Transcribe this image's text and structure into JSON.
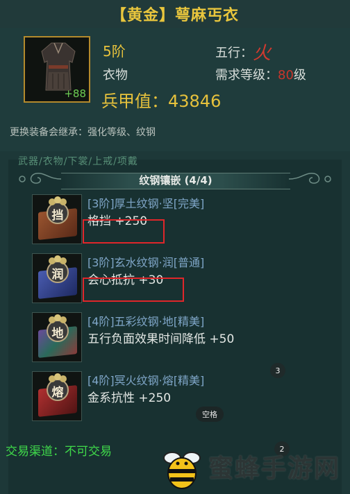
{
  "header": {
    "title": "【黄金】萼麻丐衣"
  },
  "item": {
    "enhance_level": "+88",
    "tier": "5阶",
    "type": "衣物",
    "element_label": "五行：",
    "element_glyph": "火",
    "req_label": "需求等级：",
    "req_level": "80",
    "req_suffix": "级",
    "armor_label": "兵甲值：",
    "armor_value": "43846",
    "inherit_note": "更换装备会继承：强化等级、纹钢"
  },
  "tabs": {
    "text": "武器/衣物/下裳/上戒/项戴"
  },
  "section": {
    "title": "纹钢镶嵌 (4/4)"
  },
  "gems": [
    {
      "char": "挡",
      "name": "[3阶]厚土纹钢·坚[完美]",
      "effect": "格挡    +250",
      "color": "#7a3f22"
    },
    {
      "char": "润",
      "name": "[3阶]玄水纹钢·润[普通]",
      "effect": "会心抵抗    +30",
      "color": "#2d3f86"
    },
    {
      "char": "地",
      "name": "[4阶]五彩纹钢·地[精美]",
      "effect": "五行负面效果时间降低    +50",
      "color": "#3b6a4a"
    },
    {
      "char": "熔",
      "name": "[4阶]冥火纹钢·熔[精美]",
      "effect": "金系抗性    +250",
      "color": "#8a2424"
    }
  ],
  "badges": {
    "b1": "3",
    "b2": "2"
  },
  "space_key": "空格",
  "trade": "交易渠道：不可交易",
  "watermark": {
    "text": "蜜蜂手游网"
  },
  "colors": {
    "gold": "#e7c23c",
    "red_level": "#c9362c",
    "green_trade": "#3fd94a",
    "highlight": "#e0262a"
  }
}
